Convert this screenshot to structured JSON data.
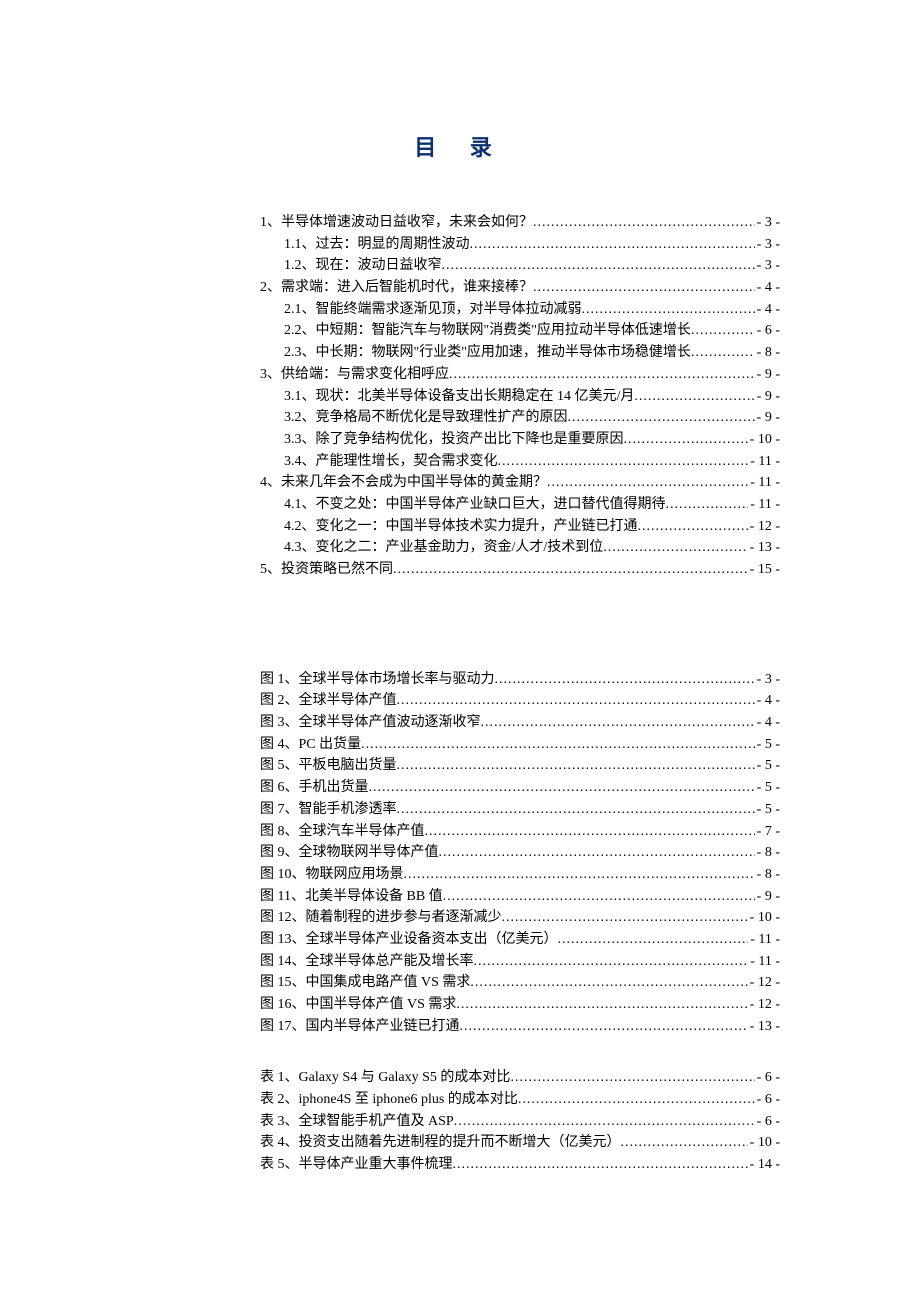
{
  "title": "目 录",
  "toc_main": [
    {
      "level": 1,
      "text": "1、半导体增速波动日益收窄，未来会如何？",
      "page": "- 3 -"
    },
    {
      "level": 2,
      "text": "1.1、过去：明显的周期性波动",
      "page": "- 3 -"
    },
    {
      "level": 2,
      "text": "1.2、现在：波动日益收窄",
      "page": "- 3 -"
    },
    {
      "level": 1,
      "text": "2、需求端：进入后智能机时代，谁来接棒？",
      "page": "- 4 -"
    },
    {
      "level": 2,
      "text": "2.1、智能终端需求逐渐见顶，对半导体拉动减弱",
      "page": "- 4 -"
    },
    {
      "level": 2,
      "text": "2.2、中短期：智能汽车与物联网\"消费类\"应用拉动半导体低速增长",
      "page": "- 6 -"
    },
    {
      "level": 2,
      "text": "2.3、中长期：物联网\"行业类\"应用加速，推动半导体市场稳健增长",
      "page": "- 8 -"
    },
    {
      "level": 1,
      "text": "3、供给端：与需求变化相呼应",
      "page": "- 9 -"
    },
    {
      "level": 2,
      "text": "3.1、现状：北美半导体设备支出长期稳定在 14 亿美元/月",
      "page": "- 9 -"
    },
    {
      "level": 2,
      "text": "3.2、竞争格局不断优化是导致理性扩产的原因",
      "page": "- 9 -"
    },
    {
      "level": 2,
      "text": "3.3、除了竞争结构优化，投资产出比下降也是重要原因",
      "page": "- 10 -"
    },
    {
      "level": 2,
      "text": "3.4、产能理性增长，契合需求变化",
      "page": "- 11 -"
    },
    {
      "level": 1,
      "text": "4、未来几年会不会成为中国半导体的黄金期？",
      "page": "- 11 -"
    },
    {
      "level": 2,
      "text": "4.1、不变之处：中国半导体产业缺口巨大，进口替代值得期待",
      "page": "- 11 -"
    },
    {
      "level": 2,
      "text": "4.2、变化之一：中国半导体技术实力提升，产业链已打通",
      "page": "- 12 -"
    },
    {
      "level": 2,
      "text": "4.3、变化之二：产业基金助力，资金/人才/技术到位",
      "page": "- 13 -"
    },
    {
      "level": 1,
      "text": "5、投资策略已然不同",
      "page": "- 15 -"
    }
  ],
  "toc_figures": [
    {
      "text": "图 1、全球半导体市场增长率与驱动力",
      "page": "- 3 -"
    },
    {
      "text": "图 2、全球半导体产值",
      "page": "- 4 -"
    },
    {
      "text": "图 3、全球半导体产值波动逐渐收窄",
      "page": "- 4 -"
    },
    {
      "text": "图 4、PC 出货量",
      "page": "- 5 -"
    },
    {
      "text": "图 5、平板电脑出货量",
      "page": "- 5 -"
    },
    {
      "text": "图 6、手机出货量",
      "page": "- 5 -"
    },
    {
      "text": "图 7、智能手机渗透率",
      "page": "- 5 -"
    },
    {
      "text": "图 8、全球汽车半导体产值",
      "page": "- 7 -"
    },
    {
      "text": "图 9、全球物联网半导体产值",
      "page": "- 8 -"
    },
    {
      "text": "图 10、物联网应用场景",
      "page": "- 8 -"
    },
    {
      "text": "图 11、北美半导体设备 BB 值",
      "page": "- 9 -"
    },
    {
      "text": "图 12、随着制程的进步参与者逐渐减少",
      "page": "- 10 -"
    },
    {
      "text": "图 13、全球半导体产业设备资本支出（亿美元）",
      "page": "- 11 -"
    },
    {
      "text": "图 14、全球半导体总产能及增长率",
      "page": "- 11 -"
    },
    {
      "text": "图 15、中国集成电路产值 VS 需求",
      "page": "- 12 -"
    },
    {
      "text": "图 16、中国半导体产值 VS 需求",
      "page": "- 12 -"
    },
    {
      "text": "图 17、国内半导体产业链已打通",
      "page": "- 13 -"
    }
  ],
  "toc_tables": [
    {
      "text": "表 1、Galaxy S4 与 Galaxy S5 的成本对比",
      "page": "- 6 -"
    },
    {
      "text": "表 2、iphone4S 至 iphone6 plus 的成本对比",
      "page": "- 6 -"
    },
    {
      "text": "表 3、全球智能手机产值及 ASP",
      "page": "- 6 -"
    },
    {
      "text": "表 4、投资支出随着先进制程的提升而不断增大（亿美元）",
      "page": "- 10 -"
    },
    {
      "text": "表 5、半导体产业重大事件梳理",
      "page": "- 14 -"
    }
  ]
}
